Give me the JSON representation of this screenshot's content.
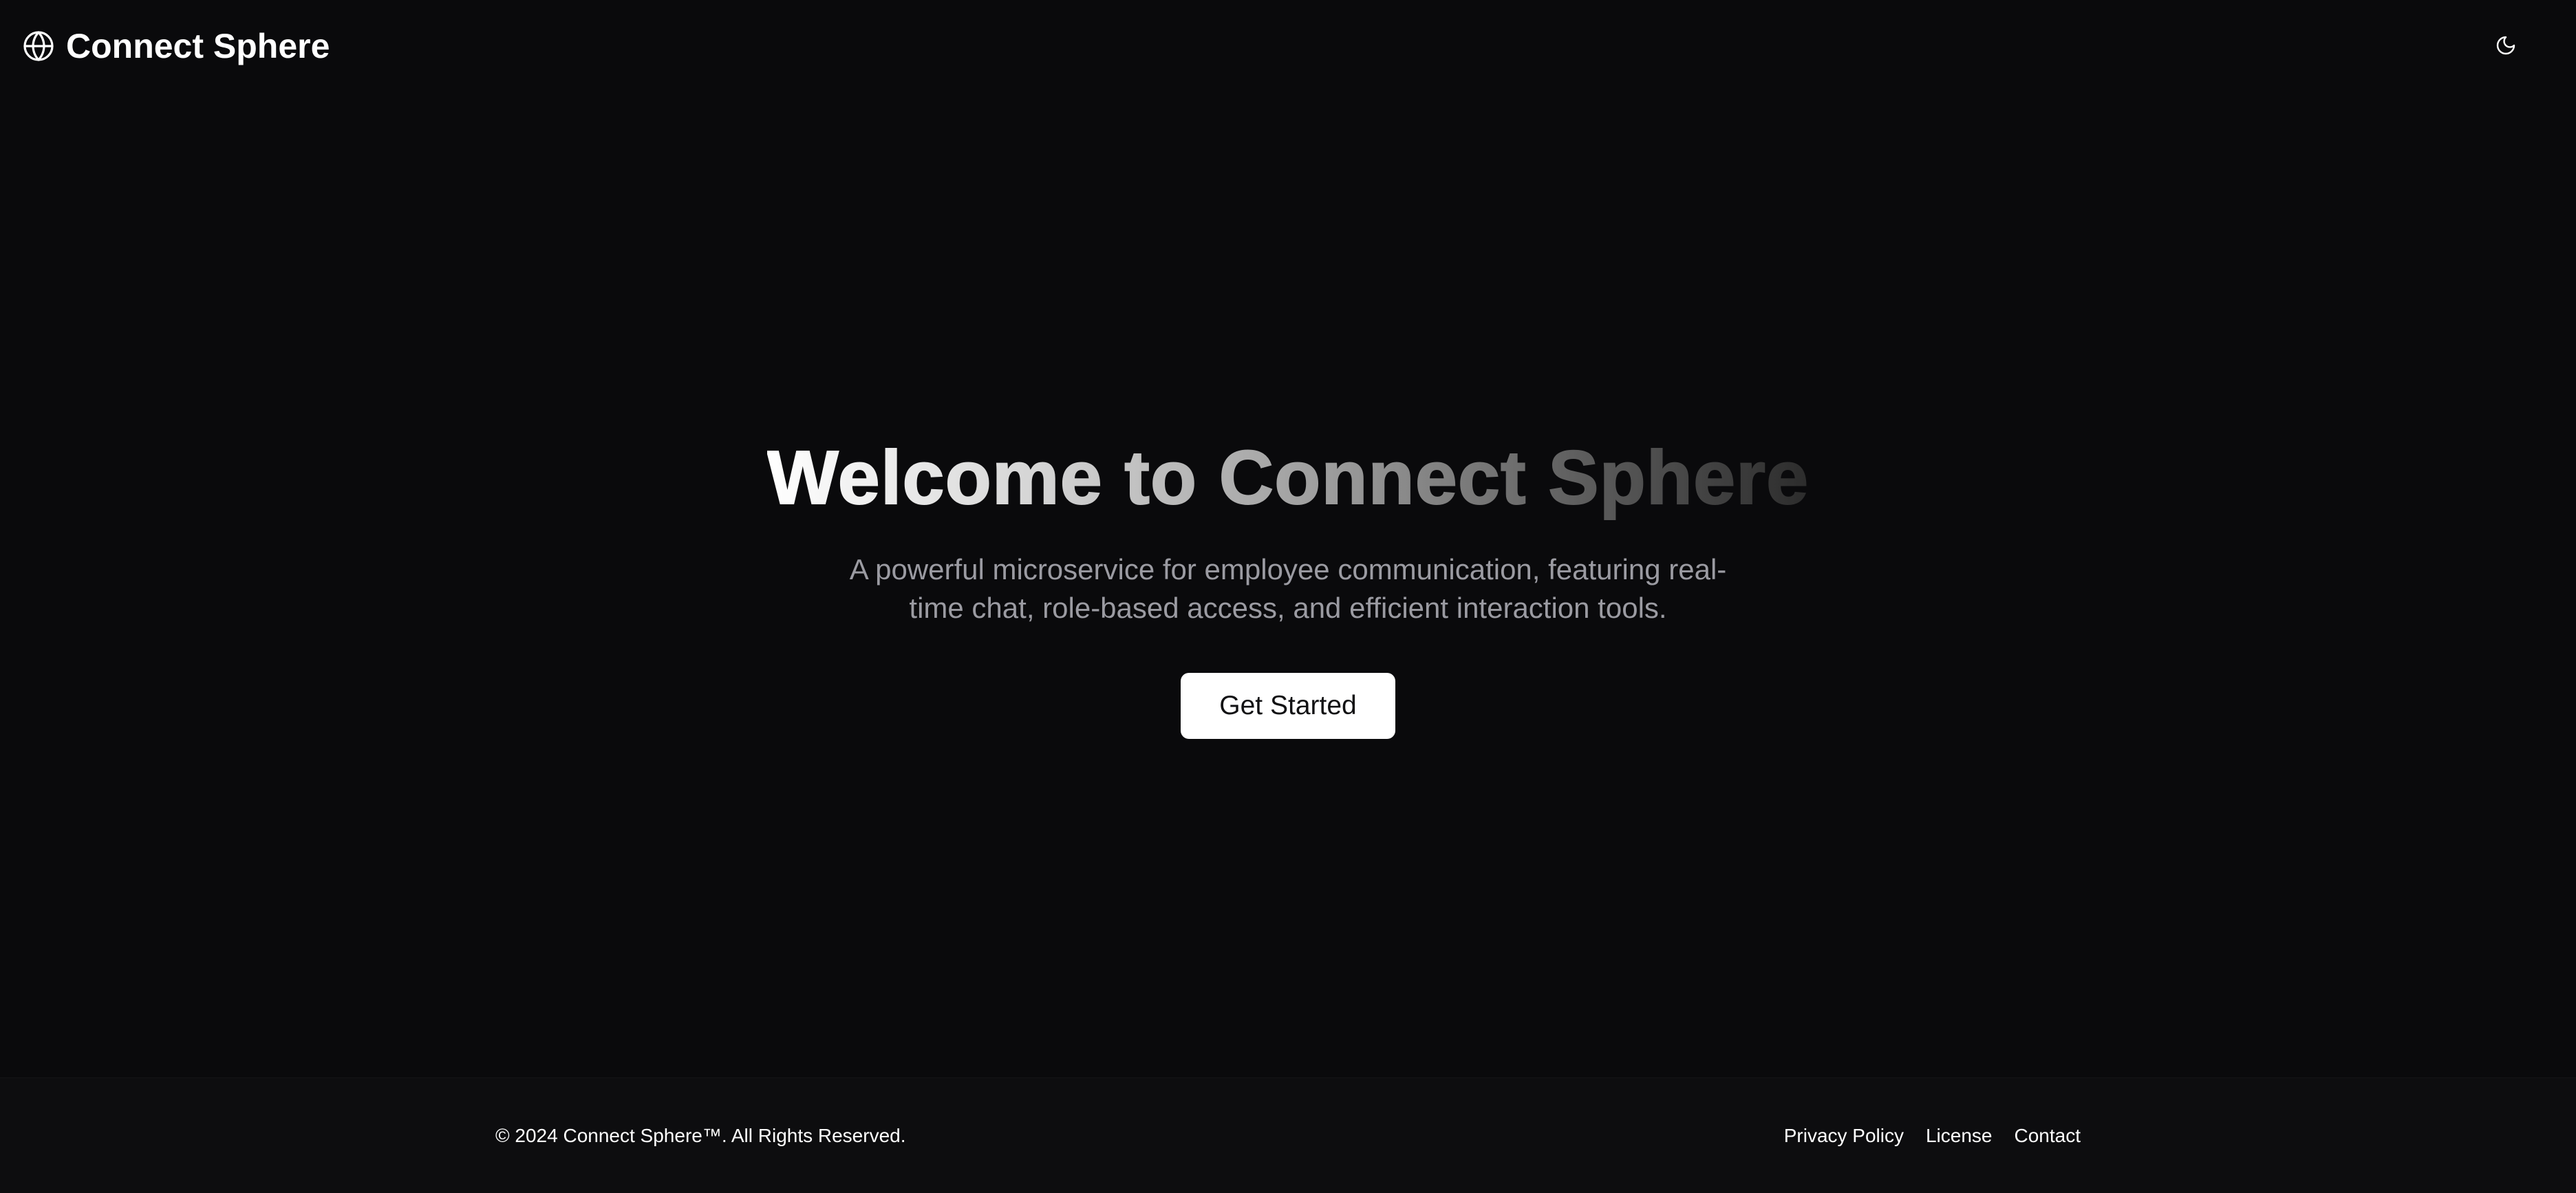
{
  "header": {
    "brand_name": "Connect Sphere",
    "brand_icon": "globe-icon",
    "theme_toggle_icon": "moon-icon"
  },
  "hero": {
    "title": "Welcome to Connect Sphere",
    "subtitle": "A powerful microservice for employee communication, featuring real-time chat, role-based access, and efficient interaction tools.",
    "cta_label": "Get Started"
  },
  "footer": {
    "copyright": "© 2024 Connect Sphere™. All Rights Reserved.",
    "links": [
      {
        "label": "Privacy Policy"
      },
      {
        "label": "License"
      },
      {
        "label": "Contact"
      }
    ]
  },
  "colors": {
    "background": "#0a0a0c",
    "footer_background": "#0d0d0f",
    "text": "#ffffff",
    "subtitle": "#9b9ba2",
    "button_background": "#ffffff",
    "button_text": "#111113"
  }
}
